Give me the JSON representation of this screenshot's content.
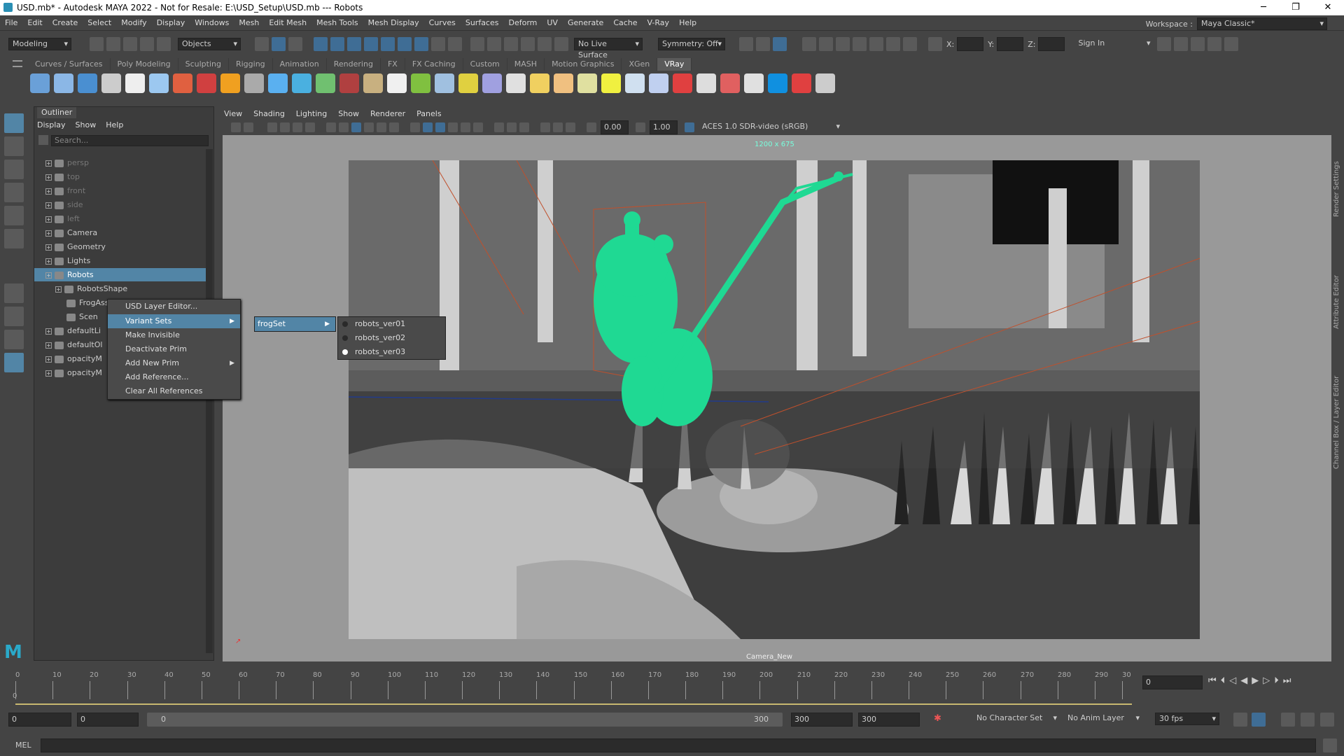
{
  "window": {
    "title": "USD.mb* - Autodesk MAYA 2022 - Not for Resale: E:\\USD_Setup\\USD.mb  ---  Robots"
  },
  "menubar": [
    "File",
    "Edit",
    "Create",
    "Select",
    "Modify",
    "Display",
    "Windows",
    "Mesh",
    "Edit Mesh",
    "Mesh Tools",
    "Mesh Display",
    "Curves",
    "Surfaces",
    "Deform",
    "UV",
    "Generate",
    "Cache",
    "V-Ray",
    "Help"
  ],
  "workspace": {
    "label": "Workspace :",
    "value": "Maya Classic*"
  },
  "statusline": {
    "mode": "Modeling",
    "objects": "Objects",
    "live_surface": "No Live Surface",
    "symmetry": "Symmetry: Off",
    "sign_in": "Sign In",
    "x": "X:",
    "y": "Y:",
    "z": "Z:"
  },
  "shelf_tabs": [
    "Curves / Surfaces",
    "Poly Modeling",
    "Sculpting",
    "Rigging",
    "Animation",
    "Rendering",
    "FX",
    "FX Caching",
    "Custom",
    "MASH",
    "Motion Graphics",
    "XGen",
    "VRay"
  ],
  "active_shelf": "VRay",
  "outliner": {
    "tab": "Outliner",
    "menu": [
      "Display",
      "Show",
      "Help"
    ],
    "search_placeholder": "Search...",
    "items": [
      {
        "label": "persp",
        "dim": true
      },
      {
        "label": "top",
        "dim": true
      },
      {
        "label": "front",
        "dim": true
      },
      {
        "label": "side",
        "dim": true
      },
      {
        "label": "left",
        "dim": true
      },
      {
        "label": "Camera",
        "dim": false
      },
      {
        "label": "Geometry",
        "dim": false
      },
      {
        "label": "Lights",
        "dim": false
      },
      {
        "label": "Robots",
        "dim": false,
        "selected": true
      },
      {
        "label": "RobotsShape",
        "dim": false
      },
      {
        "label": "FrogAsset",
        "dim": false
      },
      {
        "label": "Scen",
        "dim": false
      },
      {
        "label": "defaultLi",
        "dim": false
      },
      {
        "label": "defaultOl",
        "dim": false
      },
      {
        "label": "opacityM",
        "dim": false
      },
      {
        "label": "opacityM",
        "dim": false
      }
    ]
  },
  "context_menu": {
    "items": [
      "USD Layer Editor...",
      "Variant Sets",
      "Make Invisible",
      "Deactivate Prim",
      "Add New Prim",
      "Add Reference...",
      "Clear All References"
    ],
    "highlighted": "Variant Sets"
  },
  "variant_set": {
    "name": "frogSet",
    "options": [
      "robots_ver01",
      "robots_ver02",
      "robots_ver03"
    ],
    "selected": "robots_ver03"
  },
  "viewport": {
    "menu": [
      "View",
      "Shading",
      "Lighting",
      "Show",
      "Renderer",
      "Panels"
    ],
    "exposure": "0.00",
    "gamma": "1.00",
    "color_space": "ACES 1.0 SDR-video (sRGB)",
    "resolution": "1200 x 675",
    "camera": "Camera_New"
  },
  "side_tabs": [
    "Render Settings",
    "Attribute Editor",
    "Channel Box / Layer Editor"
  ],
  "timeline": {
    "ticks": [
      "0",
      "10",
      "20",
      "30",
      "40",
      "50",
      "60",
      "70",
      "80",
      "90",
      "100",
      "110",
      "120",
      "130",
      "140",
      "150",
      "160",
      "170",
      "180",
      "190",
      "200",
      "210",
      "220",
      "230",
      "240",
      "250",
      "260",
      "270",
      "280",
      "290",
      "30"
    ],
    "current_frame": "0",
    "frame_field": "0"
  },
  "range": {
    "start": "0",
    "anim_start": "0",
    "slider_start": "0",
    "slider_end": "300",
    "end": "300",
    "anim_end": "300",
    "character_set": "No Character Set",
    "anim_layer": "No Anim Layer",
    "fps": "30 fps"
  },
  "command_line": {
    "label": "MEL"
  }
}
